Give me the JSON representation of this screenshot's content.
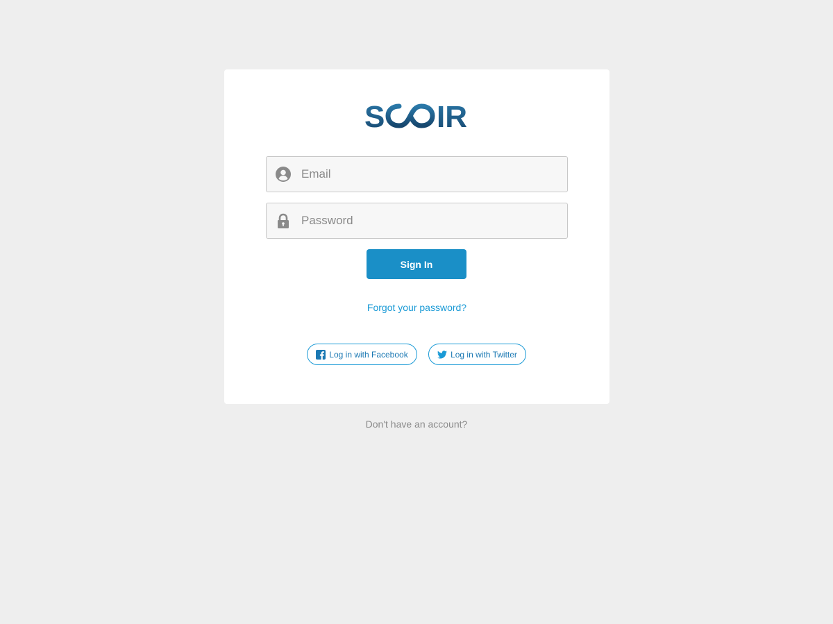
{
  "logo": {
    "text": "SCOIR",
    "color_dark": "#17476e",
    "color_light": "#2a78a8"
  },
  "form": {
    "email": {
      "icon": "user-circle-icon",
      "placeholder": "Email",
      "value": ""
    },
    "password": {
      "icon": "lock-icon",
      "placeholder": "Password",
      "value": ""
    },
    "signin_label": "Sign In",
    "forgot_label": "Forgot your password?"
  },
  "social": {
    "facebook": {
      "icon": "facebook-icon",
      "label": "Log in with Facebook"
    },
    "twitter": {
      "icon": "twitter-icon",
      "label": "Log in with Twitter"
    }
  },
  "footer": {
    "no_account_label": "Don't have an account?"
  },
  "colors": {
    "background": "#eeeeee",
    "card": "#ffffff",
    "accent": "#1a8fc7",
    "link": "#1a9ad6",
    "muted": "#8a8a8a"
  }
}
